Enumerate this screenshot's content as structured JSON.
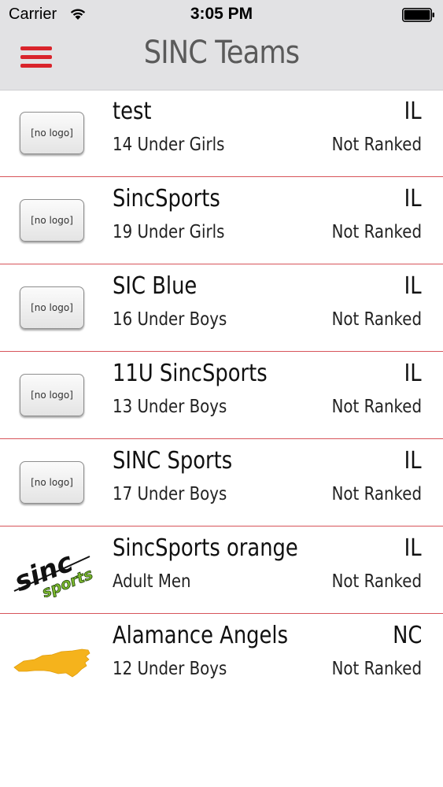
{
  "status_bar": {
    "carrier": "Carrier",
    "time": "3:05 PM",
    "wifi_icon": "wifi-icon",
    "battery_icon": "battery-icon"
  },
  "nav": {
    "title": "SINC Teams",
    "menu_icon": "hamburger-menu-icon",
    "accent_color": "#d9242b"
  },
  "teams": [
    {
      "name": "test",
      "age_group": "14 Under Girls",
      "state": "IL",
      "rank": "Not Ranked",
      "logo": "[no logo]",
      "logo_type": "none"
    },
    {
      "name": "SincSports",
      "age_group": "19 Under Girls",
      "state": "IL",
      "rank": "Not Ranked",
      "logo": "[no logo]",
      "logo_type": "none"
    },
    {
      "name": "SIC Blue",
      "age_group": "16 Under Boys",
      "state": "IL",
      "rank": "Not Ranked",
      "logo": "[no logo]",
      "logo_type": "none"
    },
    {
      "name": "11U SincSports",
      "age_group": "13 Under Boys",
      "state": "IL",
      "rank": "Not Ranked",
      "logo": "[no logo]",
      "logo_type": "none"
    },
    {
      "name": "SINC Sports",
      "age_group": "17 Under Boys",
      "state": "IL",
      "rank": "Not Ranked",
      "logo": "[no logo]",
      "logo_type": "none"
    },
    {
      "name": "SincSports orange",
      "age_group": "Adult Men",
      "state": "IL",
      "rank": "Not Ranked",
      "logo_type": "sincsports-logo",
      "logo_text": [
        "sinc",
        "sports"
      ]
    },
    {
      "name": "Alamance Angels",
      "age_group": "12 Under Boys",
      "state": "NC",
      "rank": "Not Ranked",
      "logo_type": "nc-state-map-logo"
    }
  ],
  "colors": {
    "header_bg": "#e2e2e4",
    "row_divider": "#d7545a",
    "nc_logo_color": "#f5b31c",
    "sinc_green": "#7dbb2e"
  }
}
